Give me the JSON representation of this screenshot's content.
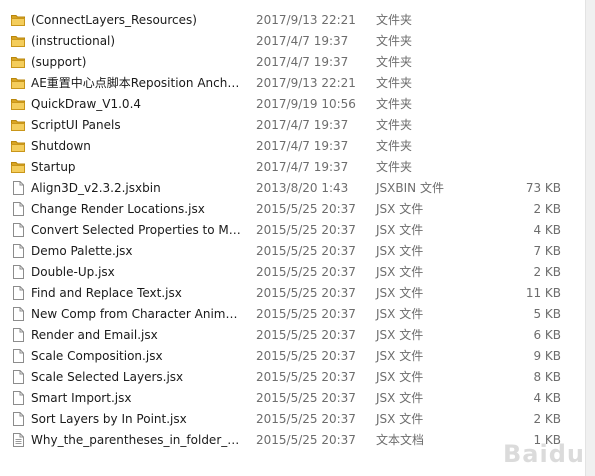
{
  "files": [
    {
      "name": "(ConnectLayers_Resources)",
      "date": "2017/9/13 22:21",
      "type": "文件夹",
      "size": "",
      "kind": "folder"
    },
    {
      "name": "(instructional)",
      "date": "2017/4/7 19:37",
      "type": "文件夹",
      "size": "",
      "kind": "folder"
    },
    {
      "name": "(support)",
      "date": "2017/4/7 19:37",
      "type": "文件夹",
      "size": "",
      "kind": "folder"
    },
    {
      "name": "AE重置中心点脚本Reposition Ancho...",
      "date": "2017/9/13 22:21",
      "type": "文件夹",
      "size": "",
      "kind": "folder"
    },
    {
      "name": "QuickDraw_V1.0.4",
      "date": "2017/9/19 10:56",
      "type": "文件夹",
      "size": "",
      "kind": "folder"
    },
    {
      "name": "ScriptUI Panels",
      "date": "2017/4/7 19:37",
      "type": "文件夹",
      "size": "",
      "kind": "folder"
    },
    {
      "name": "Shutdown",
      "date": "2017/4/7 19:37",
      "type": "文件夹",
      "size": "",
      "kind": "folder"
    },
    {
      "name": "Startup",
      "date": "2017/4/7 19:37",
      "type": "文件夹",
      "size": "",
      "kind": "folder"
    },
    {
      "name": "Align3D_v2.3.2.jsxbin",
      "date": "2013/8/20 1:43",
      "type": "JSXBIN 文件",
      "size": "73 KB",
      "kind": "file"
    },
    {
      "name": "Change Render Locations.jsx",
      "date": "2015/5/25 20:37",
      "type": "JSX 文件",
      "size": "2 KB",
      "kind": "file"
    },
    {
      "name": "Convert Selected Properties to Ma...",
      "date": "2015/5/25 20:37",
      "type": "JSX 文件",
      "size": "4 KB",
      "kind": "file"
    },
    {
      "name": "Demo Palette.jsx",
      "date": "2015/5/25 20:37",
      "type": "JSX 文件",
      "size": "7 KB",
      "kind": "file"
    },
    {
      "name": "Double-Up.jsx",
      "date": "2015/5/25 20:37",
      "type": "JSX 文件",
      "size": "2 KB",
      "kind": "file"
    },
    {
      "name": "Find and Replace Text.jsx",
      "date": "2015/5/25 20:37",
      "type": "JSX 文件",
      "size": "11 KB",
      "kind": "file"
    },
    {
      "name": "New Comp from Character Animat...",
      "date": "2015/5/25 20:37",
      "type": "JSX 文件",
      "size": "5 KB",
      "kind": "file"
    },
    {
      "name": "Render and Email.jsx",
      "date": "2015/5/25 20:37",
      "type": "JSX 文件",
      "size": "6 KB",
      "kind": "file"
    },
    {
      "name": "Scale Composition.jsx",
      "date": "2015/5/25 20:37",
      "type": "JSX 文件",
      "size": "9 KB",
      "kind": "file"
    },
    {
      "name": "Scale Selected Layers.jsx",
      "date": "2015/5/25 20:37",
      "type": "JSX 文件",
      "size": "8 KB",
      "kind": "file"
    },
    {
      "name": "Smart Import.jsx",
      "date": "2015/5/25 20:37",
      "type": "JSX 文件",
      "size": "4 KB",
      "kind": "file"
    },
    {
      "name": "Sort Layers by In Point.jsx",
      "date": "2015/5/25 20:37",
      "type": "JSX 文件",
      "size": "2 KB",
      "kind": "file"
    },
    {
      "name": "Why_the_parentheses_in_folder_na...",
      "date": "2015/5/25 20:37",
      "type": "文本文档",
      "size": "1 KB",
      "kind": "text"
    }
  ],
  "watermark": "Baidu"
}
